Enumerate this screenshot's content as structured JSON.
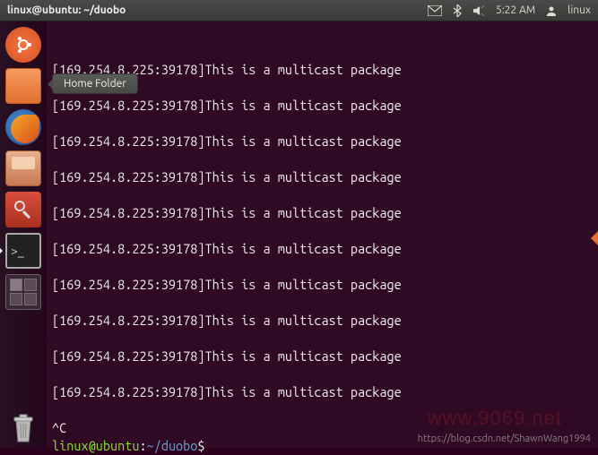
{
  "topbar": {
    "title": "linux@ubuntu: ~/duobo",
    "time": "5:22 AM",
    "user": "linux"
  },
  "tooltip": "Home Folder",
  "launcher": {
    "items": [
      {
        "name": "dash"
      },
      {
        "name": "files"
      },
      {
        "name": "firefox"
      },
      {
        "name": "software-center"
      },
      {
        "name": "settings"
      },
      {
        "name": "terminal"
      },
      {
        "name": "workspace-switcher"
      }
    ]
  },
  "terminal": {
    "lines": [
      "[169.254.8.225:39178]This is a multicast package",
      "",
      "[169.254.8.225:39178]This is a multicast package",
      "",
      "[169.254.8.225:39178]This is a multicast package",
      "",
      "[169.254.8.225:39178]This is a multicast package",
      "",
      "[169.254.8.225:39178]This is a multicast package",
      "",
      "[169.254.8.225:39178]This is a multicast package",
      "",
      "[169.254.8.225:39178]This is a multicast package",
      "",
      "[169.254.8.225:39178]This is a multicast package",
      "",
      "[169.254.8.225:39178]This is a multicast package",
      "",
      "[169.254.8.225:39178]This is a multicast package",
      "",
      "^C"
    ],
    "prompt_user_host": "linux@ubuntu",
    "prompt_colon": ":",
    "prompt_path": "~/duobo",
    "prompt_dollar": "$"
  },
  "watermark": "https://blog.csdn.net/ShawnWang1994",
  "watermark2": "www.9069.net"
}
